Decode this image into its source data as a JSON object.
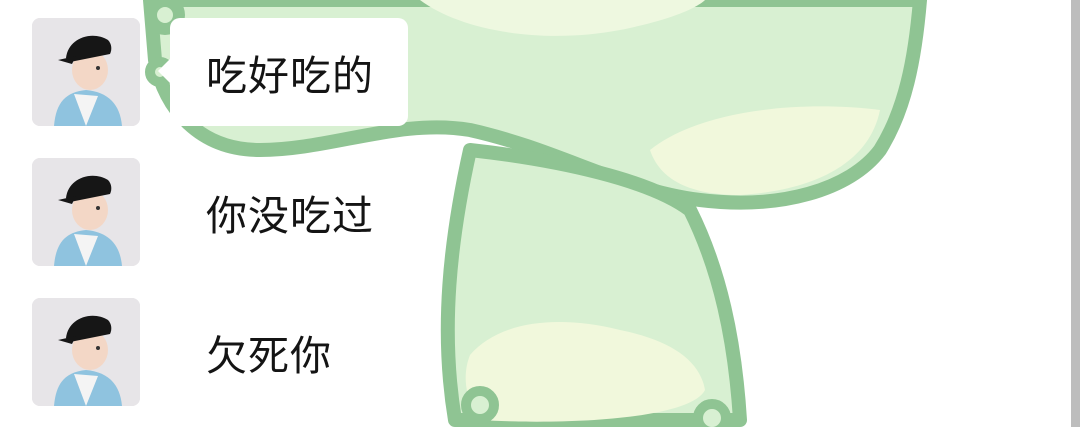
{
  "chat": {
    "messages": [
      {
        "sender": "other",
        "avatar": "child-with-cap-avatar",
        "text": "吃好吃的"
      },
      {
        "sender": "other",
        "avatar": "child-with-cap-avatar",
        "text": "你没吃过"
      },
      {
        "sender": "other",
        "avatar": "child-with-cap-avatar",
        "text": "欠死你"
      }
    ]
  },
  "colors": {
    "bubble": "#ffffff",
    "wallpaper_fill": "#d6efcf",
    "wallpaper_outline": "#8fc493",
    "scrollbar": "#bdbdbd"
  },
  "icons": {
    "wallpaper": "green-cartoon-character-wallpaper"
  }
}
